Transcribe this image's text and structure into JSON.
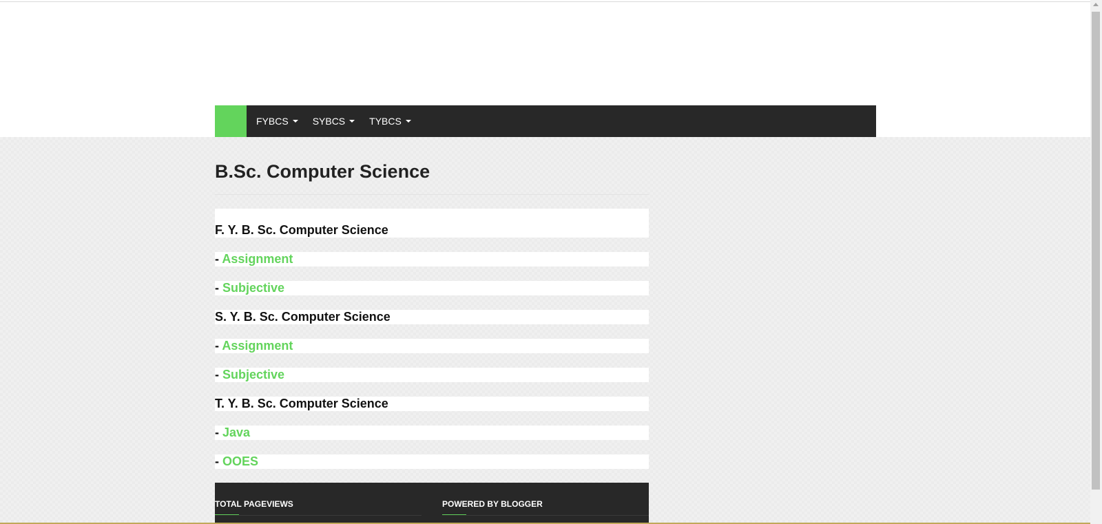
{
  "colors": {
    "accent": "#63d45c",
    "nav_bg": "#282828"
  },
  "nav": {
    "items": [
      {
        "label": "FYBCS"
      },
      {
        "label": "SYBCS"
      },
      {
        "label": "TYBCS"
      }
    ]
  },
  "page": {
    "title": "B.Sc. Computer Science"
  },
  "sections": {
    "fy": {
      "heading": "F. Y. B. Sc. Computer Science",
      "links": [
        {
          "prefix": "- ",
          "label": "Assignment"
        },
        {
          "prefix": "- ",
          "label": "Subjective"
        }
      ]
    },
    "sy": {
      "heading": "S. Y. B. Sc. Computer Science",
      "links": [
        {
          "prefix": "- ",
          "label": "Assignment"
        },
        {
          "prefix": "- ",
          "label": "Subjective"
        }
      ]
    },
    "ty": {
      "heading": "T. Y. B. Sc. Computer Science",
      "links": [
        {
          "prefix": "- ",
          "label": "Java"
        },
        {
          "prefix": "- ",
          "label": "OOES"
        }
      ]
    }
  },
  "footer": {
    "pageviews_title": "TOTAL PAGEVIEWS",
    "powered_title": "POWERED BY BLOGGER"
  }
}
